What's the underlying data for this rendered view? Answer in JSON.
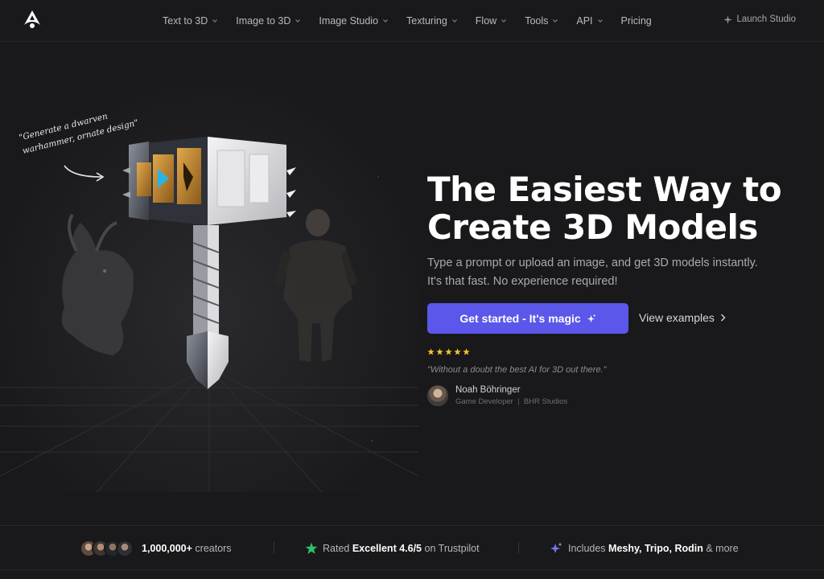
{
  "nav": {
    "items": [
      {
        "label": "Text to 3D",
        "has_menu": true
      },
      {
        "label": "Image to 3D",
        "has_menu": true
      },
      {
        "label": "Image Studio",
        "has_menu": true
      },
      {
        "label": "Texturing",
        "has_menu": true
      },
      {
        "label": "Flow",
        "has_menu": true
      },
      {
        "label": "Tools",
        "has_menu": true
      },
      {
        "label": "API",
        "has_menu": true
      },
      {
        "label": "Pricing",
        "has_menu": false
      }
    ],
    "launch_label": "Launch Studio"
  },
  "hero": {
    "annotation_line1": "\"Generate a dwarven",
    "annotation_line2": "warhammer, ornate design\"",
    "title_line1": "The Easiest Way to",
    "title_line2": "Create 3D Models",
    "subtitle_line1": "Type a prompt or upload an image, and get 3D models instantly.",
    "subtitle_line2": "It's that fast. No experience required!",
    "cta_label": "Get started - It's magic",
    "secondary_label": "View examples",
    "rating_stars": 5,
    "quote": "\"Without a doubt the best AI for 3D out there.\"",
    "author_name": "Noah Böhringer",
    "author_role": "Game Developer",
    "author_company": "BHR Studios"
  },
  "stats": {
    "creators_count": "1,000,000+",
    "creators_suffix": "creators",
    "rated_prefix": "Rated",
    "rated_value": "Excellent 4.6/5",
    "rated_suffix": "on Trustpilot",
    "includes_prefix": "Includes",
    "includes_value": "Meshy, Tripo, Rodin",
    "includes_suffix": "& more"
  },
  "colors": {
    "background": "#19191b",
    "accent": "#5b57ea",
    "star": "#f5c431",
    "trustpilot": "#2fbf6b"
  },
  "icons": {
    "logo": "logo-icon",
    "launch": "sparkle-icon",
    "cta": "sparkles-icon",
    "secondary": "chevron-right-icon",
    "includes": "ai-sparkle-icon"
  }
}
